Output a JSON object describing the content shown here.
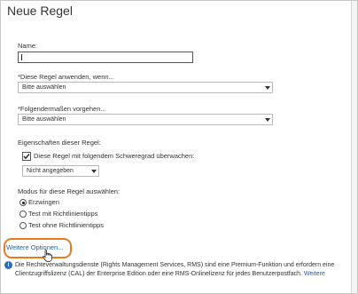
{
  "dialog": {
    "title": "Neue Regel"
  },
  "form": {
    "name_label": "Name:",
    "name_value": "",
    "apply_label": "*Diese Regel anwenden, wenn...",
    "apply_value": "Bitte auswählen",
    "action_label": "*Folgendermaßen vorgehen...",
    "action_value": "Bitte auswählen",
    "properties_label": "Eigenschaften dieser Regel:",
    "severity_checkbox_label": "Diese Regel mit folgendem Schweregrad überwachen:",
    "severity_checked": true,
    "severity_value": "Nicht angegeben",
    "mode_label": "Modus für diese Regel auswählen:",
    "mode_options": [
      {
        "label": "Erzwingen",
        "selected": true
      },
      {
        "label": "Test mit Richtlinientipps",
        "selected": false
      },
      {
        "label": "Test ohne Richtlinientipps",
        "selected": false
      }
    ]
  },
  "more_options_link": "Weitere Optionen...",
  "info": {
    "line1": "Die Rechteverwaltungsdienste (Rights Management Services, RMS) sind eine Premium-Funktion und erfordern eine",
    "line2": "Clientzugriffslizenz (CAL) der Enterprise Edition oder eine RMS-Onlinelizenz für jedes Benutzerpostfach.",
    "more_link": "Weitere"
  },
  "colors": {
    "link": "#1e5fa8",
    "highlight": "#ec7a1e",
    "info_icon": "#2f6eb5"
  }
}
